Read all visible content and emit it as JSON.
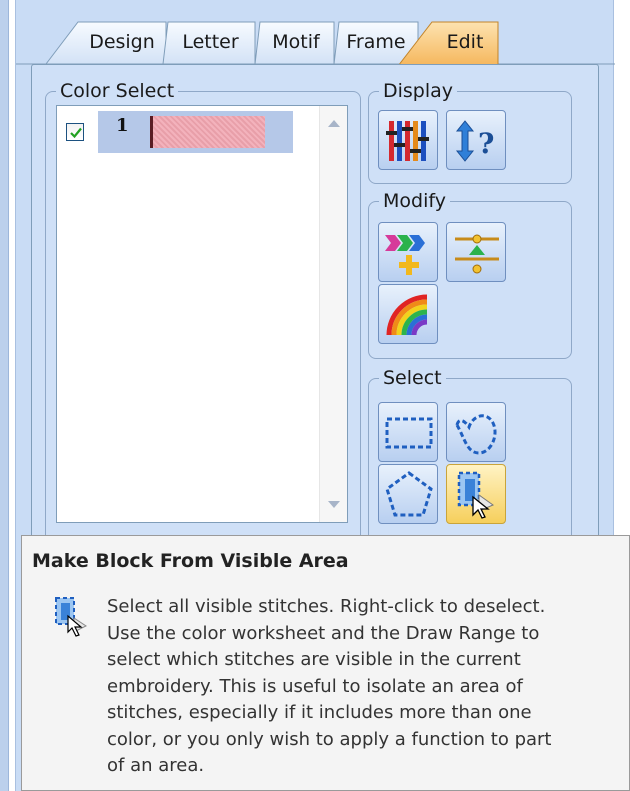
{
  "tabs": [
    {
      "label": "Design"
    },
    {
      "label": "Letter"
    },
    {
      "label": "Motif"
    },
    {
      "label": "Frame"
    },
    {
      "label": "Edit"
    }
  ],
  "active_tab": "Edit",
  "color_select": {
    "legend": "Color Select",
    "items": [
      {
        "number": "1",
        "checked": true,
        "color": "#f1a5b0"
      }
    ]
  },
  "display": {
    "legend": "Display",
    "buttons": [
      {
        "icon": "color-bars-icon"
      },
      {
        "icon": "sort-help-icon"
      }
    ]
  },
  "modify": {
    "legend": "Modify",
    "buttons": [
      {
        "icon": "arrows-plus-icon"
      },
      {
        "icon": "center-align-icon"
      },
      {
        "icon": "rainbow-icon"
      }
    ]
  },
  "select": {
    "legend": "Select",
    "buttons": [
      {
        "icon": "rectangle-select-icon"
      },
      {
        "icon": "freehand-select-icon"
      },
      {
        "icon": "polygon-select-icon"
      },
      {
        "icon": "visible-area-select-icon",
        "active": true
      }
    ]
  },
  "tooltip": {
    "title": "Make Block From Visible Area",
    "lines": [
      "Select all visible stitches. Right-click to deselect.",
      "Use the color worksheet and the Draw Range to",
      "select which stitches are visible in the current",
      "embroidery. This is useful to isolate an area of",
      "stitches, especially if it includes more than one",
      "color, or you only wish to apply a function to part",
      "of an area."
    ]
  },
  "colors": {
    "panel_bg": "#c9dcf5",
    "active_tab": "#f7c27a",
    "tooltip_bg": "#f4f4f4"
  }
}
